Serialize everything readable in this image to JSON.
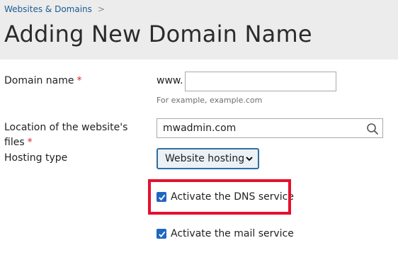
{
  "breadcrumb": {
    "items": [
      "Websites & Domains"
    ],
    "separator": ">"
  },
  "page_title": "Adding New Domain Name",
  "form": {
    "domain": {
      "label": "Domain name",
      "required_mark": "*",
      "prefix": "www.",
      "value": "",
      "hint": "For example, example.com"
    },
    "location": {
      "label_line1": "Location of the website's",
      "label_line2": "files",
      "required_mark": "*",
      "value": "mwadmin.com"
    },
    "hosting_type": {
      "label": "Hosting type",
      "selected": "Website hosting"
    },
    "checkboxes": [
      {
        "label": "Activate the DNS service",
        "checked": true,
        "highlighted": true
      },
      {
        "label": "Activate the mail service",
        "checked": true,
        "highlighted": false
      }
    ]
  },
  "colors": {
    "header_bg": "#ececec",
    "link": "#1a5b93",
    "required": "#d02b2b",
    "checkbox": "#1f66c2",
    "highlight_box": "#e5102d",
    "select_border": "#2f6e9e"
  },
  "icons": [
    "search-icon",
    "chevron-down-icon",
    "checkmark-icon",
    "breadcrumb-chevron-icon"
  ]
}
